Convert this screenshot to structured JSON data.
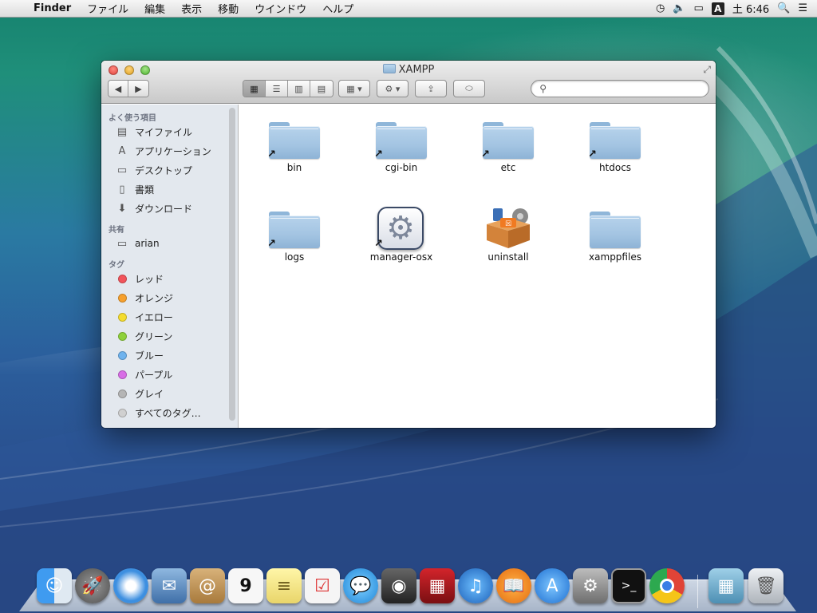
{
  "menubar": {
    "app_name": "Finder",
    "items": [
      "ファイル",
      "編集",
      "表示",
      "移動",
      "ウインドウ",
      "ヘルプ"
    ],
    "input_mode": "A",
    "clock": "土 6:46"
  },
  "window": {
    "title": "XAMPP",
    "search_value": ""
  },
  "sidebar": {
    "favorites_header": "よく使う項目",
    "favorites": [
      {
        "label": "マイファイル",
        "icon": "all-my-files-icon"
      },
      {
        "label": "アプリケーション",
        "icon": "applications-icon"
      },
      {
        "label": "デスクトップ",
        "icon": "desktop-icon"
      },
      {
        "label": "書類",
        "icon": "documents-icon"
      },
      {
        "label": "ダウンロード",
        "icon": "downloads-icon"
      }
    ],
    "shared_header": "共有",
    "shared": [
      {
        "label": "arian",
        "icon": "computer-icon"
      }
    ],
    "tags_header": "タグ",
    "tags": [
      {
        "label": "レッド",
        "color": "#f2545b"
      },
      {
        "label": "オレンジ",
        "color": "#f6a02d"
      },
      {
        "label": "イエロー",
        "color": "#f4dc2f"
      },
      {
        "label": "グリーン",
        "color": "#8fd13b"
      },
      {
        "label": "ブルー",
        "color": "#6fb3ee"
      },
      {
        "label": "パープル",
        "color": "#d86ee6"
      },
      {
        "label": "グレイ",
        "color": "#b5b5b5"
      },
      {
        "label": "すべてのタグ…",
        "color": "#d0d0d0"
      }
    ]
  },
  "files": [
    {
      "name": "bin",
      "kind": "folder-alias"
    },
    {
      "name": "cgi-bin",
      "kind": "folder-alias"
    },
    {
      "name": "etc",
      "kind": "folder-alias"
    },
    {
      "name": "htdocs",
      "kind": "folder-alias"
    },
    {
      "name": "logs",
      "kind": "folder-alias"
    },
    {
      "name": "manager-osx",
      "kind": "app-alias"
    },
    {
      "name": "uninstall",
      "kind": "app"
    },
    {
      "name": "xamppfiles",
      "kind": "folder"
    }
  ],
  "dock": [
    {
      "name": "finder",
      "color": "#3b8de0"
    },
    {
      "name": "launchpad",
      "color": "#6e6e6e"
    },
    {
      "name": "safari",
      "color": "#2f7fd8"
    },
    {
      "name": "mail",
      "color": "#4b7fb8"
    },
    {
      "name": "contacts",
      "color": "#b98a4a"
    },
    {
      "name": "calendar",
      "color": "#f4f4f4"
    },
    {
      "name": "notes",
      "color": "#f2e58a"
    },
    {
      "name": "reminders",
      "color": "#f7f7f7"
    },
    {
      "name": "messages",
      "color": "#3aa0e8"
    },
    {
      "name": "facetime",
      "color": "#444444"
    },
    {
      "name": "photo-booth",
      "color": "#b3181e"
    },
    {
      "name": "itunes",
      "color": "#2b7fd5"
    },
    {
      "name": "ibooks",
      "color": "#f08a1d"
    },
    {
      "name": "app-store",
      "color": "#2b8ee3"
    },
    {
      "name": "system-preferences",
      "color": "#8b8b8b"
    },
    {
      "name": "terminal",
      "color": "#1d1d1d"
    },
    {
      "name": "chrome",
      "color": "#e8e8e8"
    },
    {
      "name": "stack-folder",
      "color": "#6fa7c9"
    },
    {
      "name": "trash",
      "color": "#cfd3d8"
    }
  ],
  "calendar_day": "9"
}
